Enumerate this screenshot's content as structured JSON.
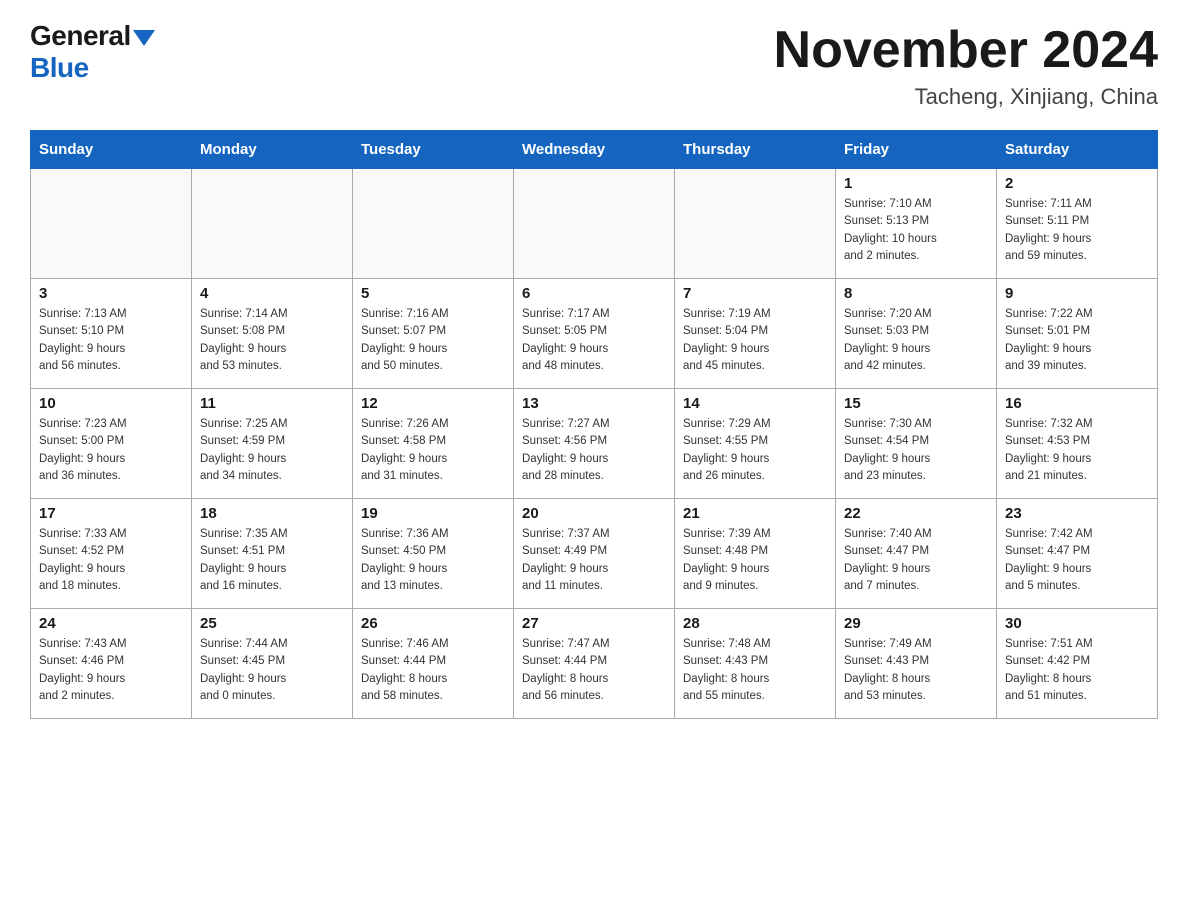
{
  "header": {
    "logo_general": "General",
    "logo_blue": "Blue",
    "month_title": "November 2024",
    "subtitle": "Tacheng, Xinjiang, China"
  },
  "weekdays": [
    "Sunday",
    "Monday",
    "Tuesday",
    "Wednesday",
    "Thursday",
    "Friday",
    "Saturday"
  ],
  "weeks": [
    [
      {
        "day": "",
        "info": ""
      },
      {
        "day": "",
        "info": ""
      },
      {
        "day": "",
        "info": ""
      },
      {
        "day": "",
        "info": ""
      },
      {
        "day": "",
        "info": ""
      },
      {
        "day": "1",
        "info": "Sunrise: 7:10 AM\nSunset: 5:13 PM\nDaylight: 10 hours\nand 2 minutes."
      },
      {
        "day": "2",
        "info": "Sunrise: 7:11 AM\nSunset: 5:11 PM\nDaylight: 9 hours\nand 59 minutes."
      }
    ],
    [
      {
        "day": "3",
        "info": "Sunrise: 7:13 AM\nSunset: 5:10 PM\nDaylight: 9 hours\nand 56 minutes."
      },
      {
        "day": "4",
        "info": "Sunrise: 7:14 AM\nSunset: 5:08 PM\nDaylight: 9 hours\nand 53 minutes."
      },
      {
        "day": "5",
        "info": "Sunrise: 7:16 AM\nSunset: 5:07 PM\nDaylight: 9 hours\nand 50 minutes."
      },
      {
        "day": "6",
        "info": "Sunrise: 7:17 AM\nSunset: 5:05 PM\nDaylight: 9 hours\nand 48 minutes."
      },
      {
        "day": "7",
        "info": "Sunrise: 7:19 AM\nSunset: 5:04 PM\nDaylight: 9 hours\nand 45 minutes."
      },
      {
        "day": "8",
        "info": "Sunrise: 7:20 AM\nSunset: 5:03 PM\nDaylight: 9 hours\nand 42 minutes."
      },
      {
        "day": "9",
        "info": "Sunrise: 7:22 AM\nSunset: 5:01 PM\nDaylight: 9 hours\nand 39 minutes."
      }
    ],
    [
      {
        "day": "10",
        "info": "Sunrise: 7:23 AM\nSunset: 5:00 PM\nDaylight: 9 hours\nand 36 minutes."
      },
      {
        "day": "11",
        "info": "Sunrise: 7:25 AM\nSunset: 4:59 PM\nDaylight: 9 hours\nand 34 minutes."
      },
      {
        "day": "12",
        "info": "Sunrise: 7:26 AM\nSunset: 4:58 PM\nDaylight: 9 hours\nand 31 minutes."
      },
      {
        "day": "13",
        "info": "Sunrise: 7:27 AM\nSunset: 4:56 PM\nDaylight: 9 hours\nand 28 minutes."
      },
      {
        "day": "14",
        "info": "Sunrise: 7:29 AM\nSunset: 4:55 PM\nDaylight: 9 hours\nand 26 minutes."
      },
      {
        "day": "15",
        "info": "Sunrise: 7:30 AM\nSunset: 4:54 PM\nDaylight: 9 hours\nand 23 minutes."
      },
      {
        "day": "16",
        "info": "Sunrise: 7:32 AM\nSunset: 4:53 PM\nDaylight: 9 hours\nand 21 minutes."
      }
    ],
    [
      {
        "day": "17",
        "info": "Sunrise: 7:33 AM\nSunset: 4:52 PM\nDaylight: 9 hours\nand 18 minutes."
      },
      {
        "day": "18",
        "info": "Sunrise: 7:35 AM\nSunset: 4:51 PM\nDaylight: 9 hours\nand 16 minutes."
      },
      {
        "day": "19",
        "info": "Sunrise: 7:36 AM\nSunset: 4:50 PM\nDaylight: 9 hours\nand 13 minutes."
      },
      {
        "day": "20",
        "info": "Sunrise: 7:37 AM\nSunset: 4:49 PM\nDaylight: 9 hours\nand 11 minutes."
      },
      {
        "day": "21",
        "info": "Sunrise: 7:39 AM\nSunset: 4:48 PM\nDaylight: 9 hours\nand 9 minutes."
      },
      {
        "day": "22",
        "info": "Sunrise: 7:40 AM\nSunset: 4:47 PM\nDaylight: 9 hours\nand 7 minutes."
      },
      {
        "day": "23",
        "info": "Sunrise: 7:42 AM\nSunset: 4:47 PM\nDaylight: 9 hours\nand 5 minutes."
      }
    ],
    [
      {
        "day": "24",
        "info": "Sunrise: 7:43 AM\nSunset: 4:46 PM\nDaylight: 9 hours\nand 2 minutes."
      },
      {
        "day": "25",
        "info": "Sunrise: 7:44 AM\nSunset: 4:45 PM\nDaylight: 9 hours\nand 0 minutes."
      },
      {
        "day": "26",
        "info": "Sunrise: 7:46 AM\nSunset: 4:44 PM\nDaylight: 8 hours\nand 58 minutes."
      },
      {
        "day": "27",
        "info": "Sunrise: 7:47 AM\nSunset: 4:44 PM\nDaylight: 8 hours\nand 56 minutes."
      },
      {
        "day": "28",
        "info": "Sunrise: 7:48 AM\nSunset: 4:43 PM\nDaylight: 8 hours\nand 55 minutes."
      },
      {
        "day": "29",
        "info": "Sunrise: 7:49 AM\nSunset: 4:43 PM\nDaylight: 8 hours\nand 53 minutes."
      },
      {
        "day": "30",
        "info": "Sunrise: 7:51 AM\nSunset: 4:42 PM\nDaylight: 8 hours\nand 51 minutes."
      }
    ]
  ]
}
